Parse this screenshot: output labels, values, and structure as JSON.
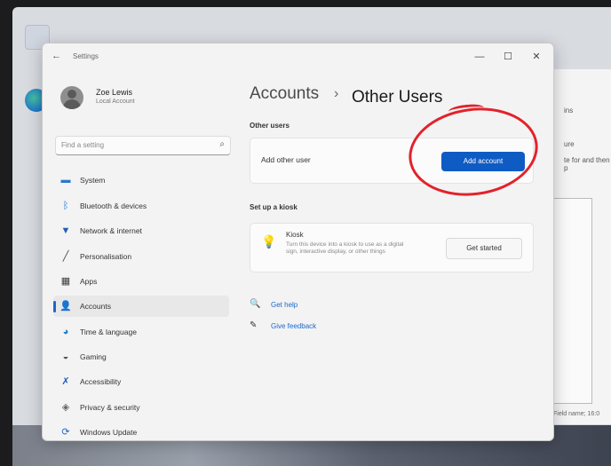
{
  "window": {
    "app_title": "Settings",
    "back_glyph": "←",
    "minimize_glyph": "—",
    "maximize_glyph": "☐",
    "close_glyph": "✕"
  },
  "profile": {
    "name": "Zoe Lewis",
    "account": "Local Account"
  },
  "search": {
    "placeholder": "Find a setting",
    "icon": "search-icon"
  },
  "sidebar": {
    "items": [
      {
        "label": "System",
        "icon": "monitor-icon",
        "color": "#2a78d2"
      },
      {
        "label": "Bluetooth & devices",
        "icon": "bluetooth-icon",
        "color": "#1f6fd1"
      },
      {
        "label": "Network & internet",
        "icon": "wifi-icon",
        "color": "#1f5fb4"
      },
      {
        "label": "Personalisation",
        "icon": "brush-icon",
        "color": "#444444"
      },
      {
        "label": "Apps",
        "icon": "apps-icon",
        "color": "#3a3a3a"
      },
      {
        "label": "Accounts",
        "icon": "person-icon",
        "color": "#2e8b57",
        "active": true
      },
      {
        "label": "Time & language",
        "icon": "globe-clock-icon",
        "color": "#1d7fcf"
      },
      {
        "label": "Gaming",
        "icon": "gamepad-icon",
        "color": "#555555"
      },
      {
        "label": "Accessibility",
        "icon": "accessibility-icon",
        "color": "#1c5fc0"
      },
      {
        "label": "Privacy & security",
        "icon": "shield-icon",
        "color": "#666666"
      },
      {
        "label": "Windows Update",
        "icon": "update-icon",
        "color": "#1c69c9"
      }
    ]
  },
  "breadcrumb": {
    "parent": "Accounts",
    "separator": "›",
    "current": "Other Users"
  },
  "other_users": {
    "section_label": "Other users",
    "row_label": "Add other user",
    "button_label": "Add account"
  },
  "kiosk": {
    "section_label": "Set up a kiosk",
    "title": "Kiosk",
    "description": "Turn this device into a kiosk to use as a digital sign, interactive display, or other things",
    "button_label": "Get started"
  },
  "links": {
    "help": "Get help",
    "feedback": "Give feedback"
  },
  "background_window": {
    "line1": "ins",
    "line2": "ure",
    "line3": "te for and then p",
    "footer": "Field name; 16:0"
  },
  "colors": {
    "accent": "#0f5bc4",
    "annotation": "#e2222b"
  }
}
